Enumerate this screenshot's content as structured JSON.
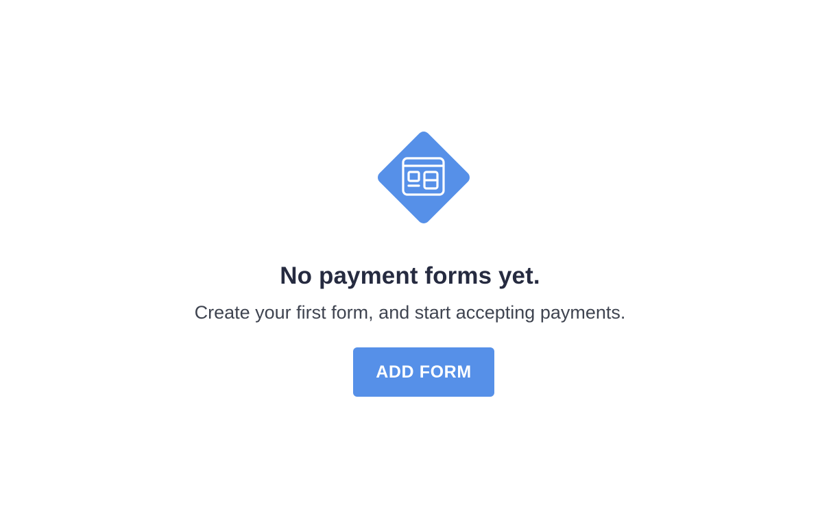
{
  "empty_state": {
    "icon": "form-layout-icon",
    "title": "No payment forms yet.",
    "description": "Create your first form, and start accepting payments.",
    "button_label": "ADD FORM"
  },
  "colors": {
    "accent": "#5690e8",
    "title": "#262b40",
    "description": "#3f4450",
    "background": "#ffffff"
  }
}
